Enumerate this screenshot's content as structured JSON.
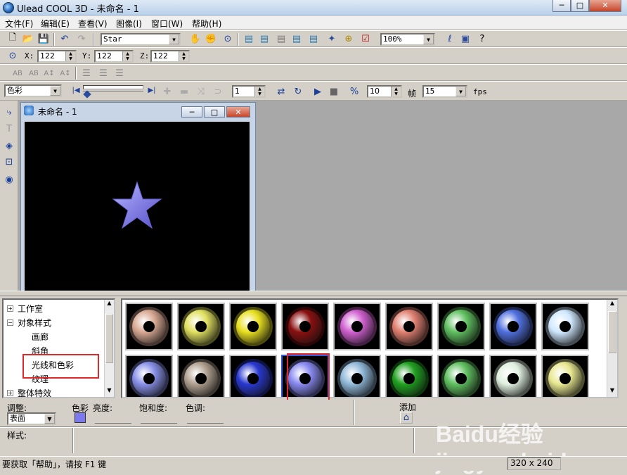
{
  "window": {
    "title": "Ulead COOL 3D - 未命名 - 1",
    "min": "─",
    "max": "□",
    "close": "✕"
  },
  "menu": [
    "文件(F)",
    "编辑(E)",
    "查看(V)",
    "图像(I)",
    "窗口(W)",
    "帮助(H)"
  ],
  "toolbar": {
    "object_select": "Star",
    "zoom": "100%"
  },
  "coords": {
    "x_label": "X:",
    "x": "122",
    "y_label": "Y:",
    "y": "122",
    "z_label": "Z:",
    "z": "122"
  },
  "text_tools": [
    "AB",
    "AB",
    "A↕",
    "A↕"
  ],
  "anim": {
    "attr_select": "色彩",
    "frame": "1",
    "total_frames": "10",
    "frames_label": "帧",
    "fps": "15",
    "fps_label": "fps"
  },
  "doc": {
    "title": "未命名 - 1",
    "object": "star"
  },
  "tree": {
    "items": [
      {
        "label": "工作室",
        "exp": "+"
      },
      {
        "label": "对象样式",
        "exp": "−"
      },
      {
        "label": "画廊",
        "exp": ""
      },
      {
        "label": "斜角",
        "exp": ""
      },
      {
        "label": "光线和色彩",
        "exp": ""
      },
      {
        "label": "纹理",
        "exp": ""
      },
      {
        "label": "整体特效",
        "exp": "+"
      }
    ]
  },
  "gallery": {
    "row1": [
      "#d8a892",
      "#e0e060",
      "#e8e020",
      "#8a1010",
      "#d060d0",
      "#e08070",
      "#60c060",
      "#5070e0",
      "#d0e8ff"
    ],
    "row2": [
      "#8890e8",
      "#b0a090",
      "#2838d0",
      "#8888f0",
      "#90b8d8",
      "#20a020",
      "#60c060",
      "#e0f0e0",
      "#e8e890"
    ],
    "selected_index": 12
  },
  "controls": {
    "adjust_label": "调整:",
    "adjust_value": "表面",
    "color_label": "色彩",
    "brightness_label": "亮度:",
    "saturation_label": "饱和度:",
    "hue_label": "色调:",
    "add_label": "添加",
    "style_label": "样式:",
    "swatch_color": "#7b78f0"
  },
  "status": {
    "hint": "要获取「帮助」，请按 F1 键",
    "size": "320 x 240"
  },
  "watermark": "Baidu经验 jingyan.baidu.com"
}
